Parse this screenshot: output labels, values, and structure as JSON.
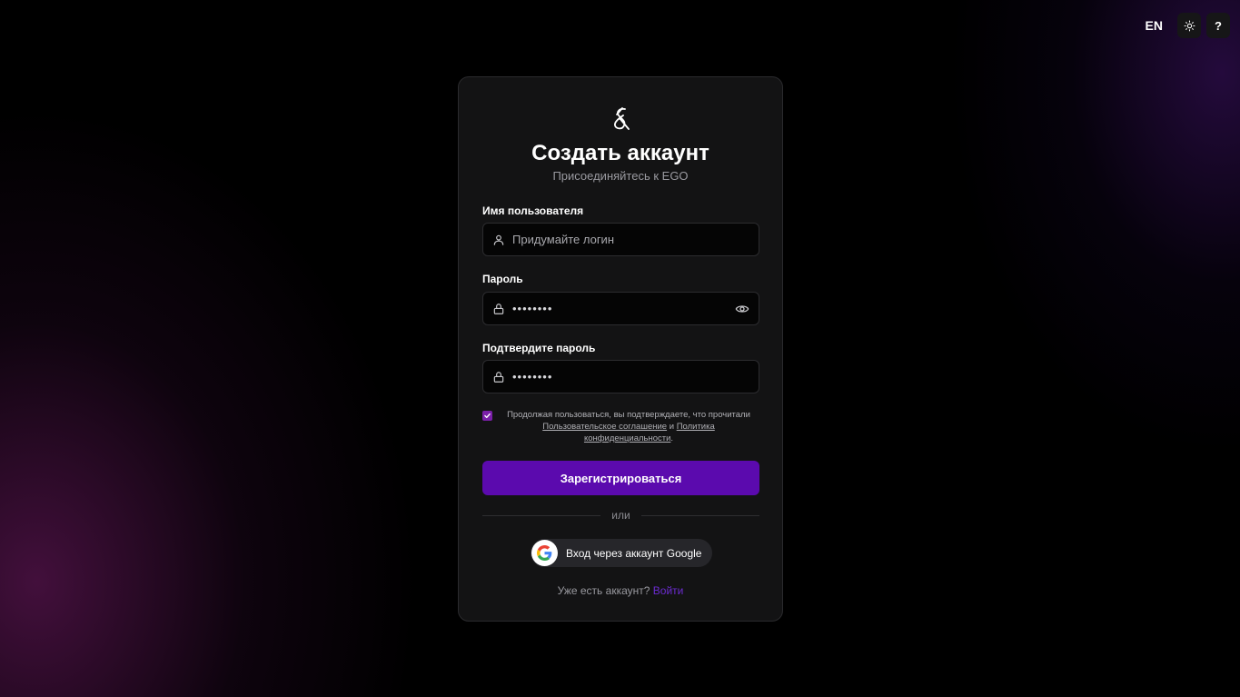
{
  "topbar": {
    "lang_label": "EN",
    "theme_icon": "sun-icon",
    "help_label": "?"
  },
  "card": {
    "logo_icon": "ego-logo-icon",
    "title": "Создать аккаунт",
    "subtitle": "Присоединяйтесь к EGO"
  },
  "form": {
    "username": {
      "label": "Имя пользователя",
      "placeholder": "Придумайте логин",
      "value": "",
      "icon": "user-icon"
    },
    "password": {
      "label": "Пароль",
      "value": "••••••••",
      "icon": "lock-icon",
      "toggle_icon": "eye-icon"
    },
    "confirm_password": {
      "label": "Подтвердите пароль",
      "value": "••••••••",
      "icon": "lock-icon"
    },
    "terms": {
      "checked": true,
      "text_before": "Продолжая пользоваться, вы подтверждаете, что прочитали",
      "user_agreement_link": "Пользовательское соглашение",
      "conjunction": "и",
      "privacy_link": "Политика конфиденциальности",
      "period": "."
    },
    "submit_label": "Зарегистрироваться",
    "divider_text": "или",
    "google_label": "Вход через аккаунт Google",
    "footer_text": "Уже есть аккаунт?",
    "login_link": "Войти"
  },
  "colors": {
    "accent": "#5b0aae",
    "checkbox": "#7a1fa8",
    "link": "#6b2bd0",
    "card_bg": "#131314"
  }
}
